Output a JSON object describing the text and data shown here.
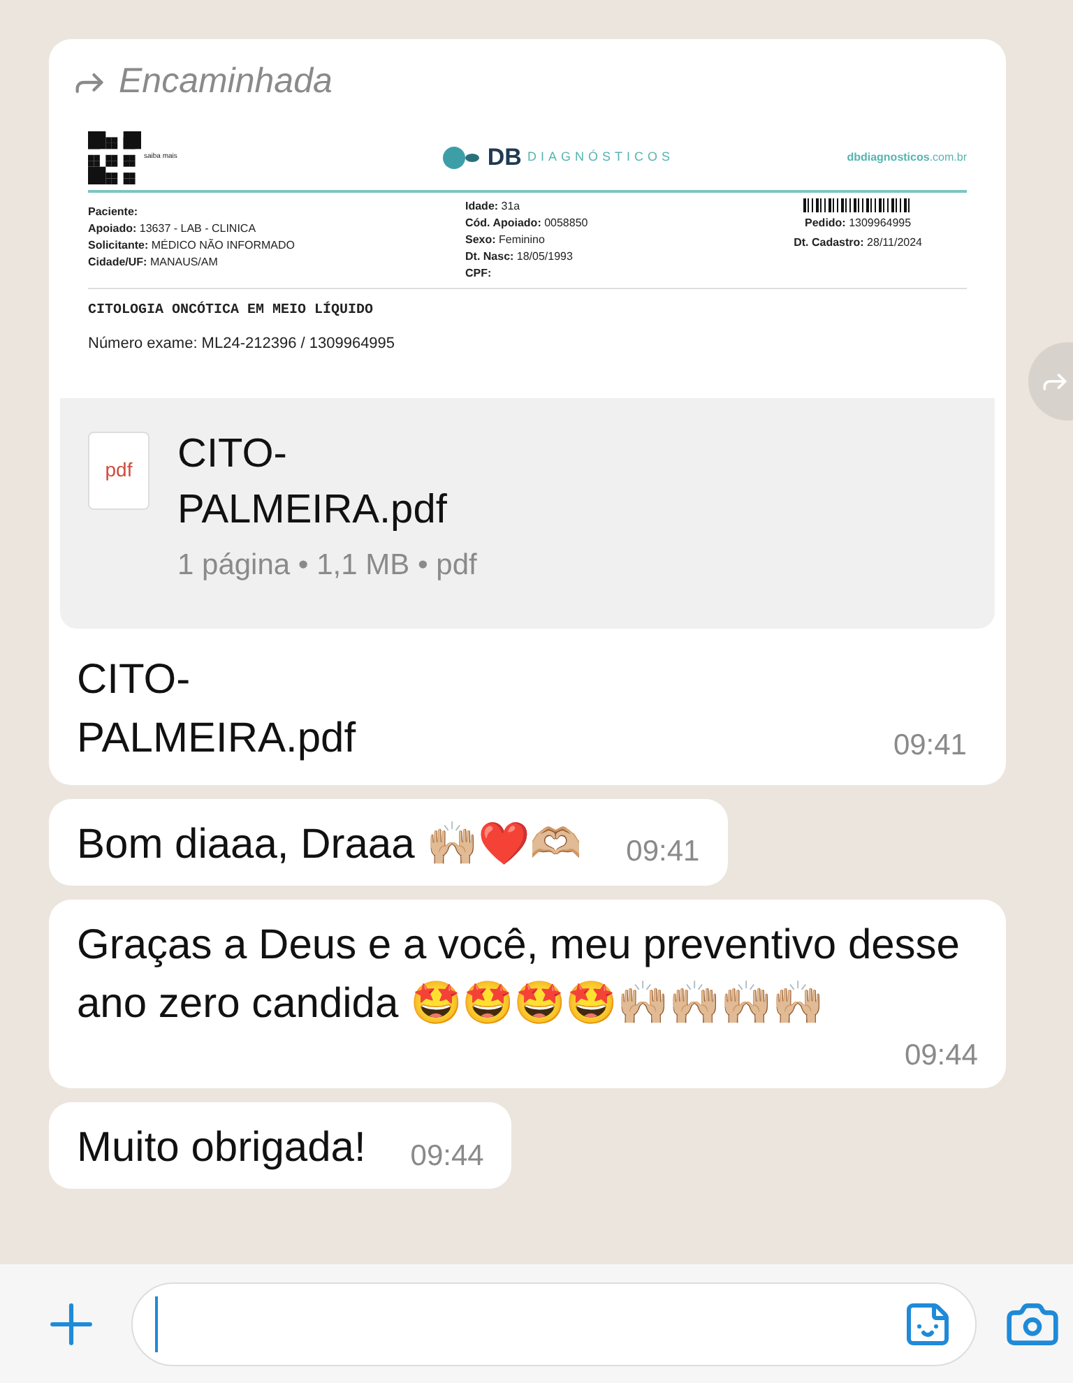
{
  "forwarded_label": "Encaminhada",
  "document_preview": {
    "qr_caption": "saiba mais",
    "logo": "DB",
    "logo_subtitle": "DIAGNÓSTICOS",
    "website_bold": "dbdiagnosticos",
    "website_rest": ".com.br",
    "left_fields": [
      {
        "label": "Paciente:"
      },
      {
        "label": "Apoiado:",
        "value": "13637 - LAB - CLINICA"
      },
      {
        "label": "Solicitante:",
        "value": "MÉDICO NÃO INFORMADO"
      },
      {
        "label": "Cidade/UF:",
        "value": "MANAUS/AM"
      }
    ],
    "middle_fields": [
      {
        "label": "Idade:",
        "value": "31a"
      },
      {
        "label": "Cód. Apoiado:",
        "value": "0058850"
      },
      {
        "label": "Sexo:",
        "value": "Feminino"
      },
      {
        "label": "Dt. Nasc:",
        "value": "18/05/1993"
      },
      {
        "label": "CPF:"
      }
    ],
    "right_fields": [
      {
        "label": "Pedido:",
        "value": "1309964995"
      },
      {
        "label": "Dt. Cadastro:",
        "value": "28/11/2024"
      }
    ],
    "exam_title": "CITOLOGIA ONCÓTICA EM MEIO LÍQUIDO",
    "exam_number": "Número exame: ML24-212396 / 1309964995"
  },
  "file": {
    "icon_label": "pdf",
    "name_lines": [
      "CITO-",
      "PALMEIRA.pdf"
    ],
    "meta": "1 página • 1,1 MB • pdf"
  },
  "caption": {
    "lines": [
      "CITO-",
      "PALMEIRA.pdf"
    ],
    "time": "09:41"
  },
  "messages": [
    {
      "text": "Bom diaaa, Draaa 🙌🏼❤️🫶🏼",
      "time": "09:41"
    },
    {
      "text": "Graças a Deus e a você, meu preventivo desse ano zero candida 🤩🤩🤩🤩🙌🏼🙌🏼🙌🏼🙌🏼",
      "time": "09:44"
    },
    {
      "text": "Muito obrigada!",
      "time": "09:44"
    }
  ]
}
